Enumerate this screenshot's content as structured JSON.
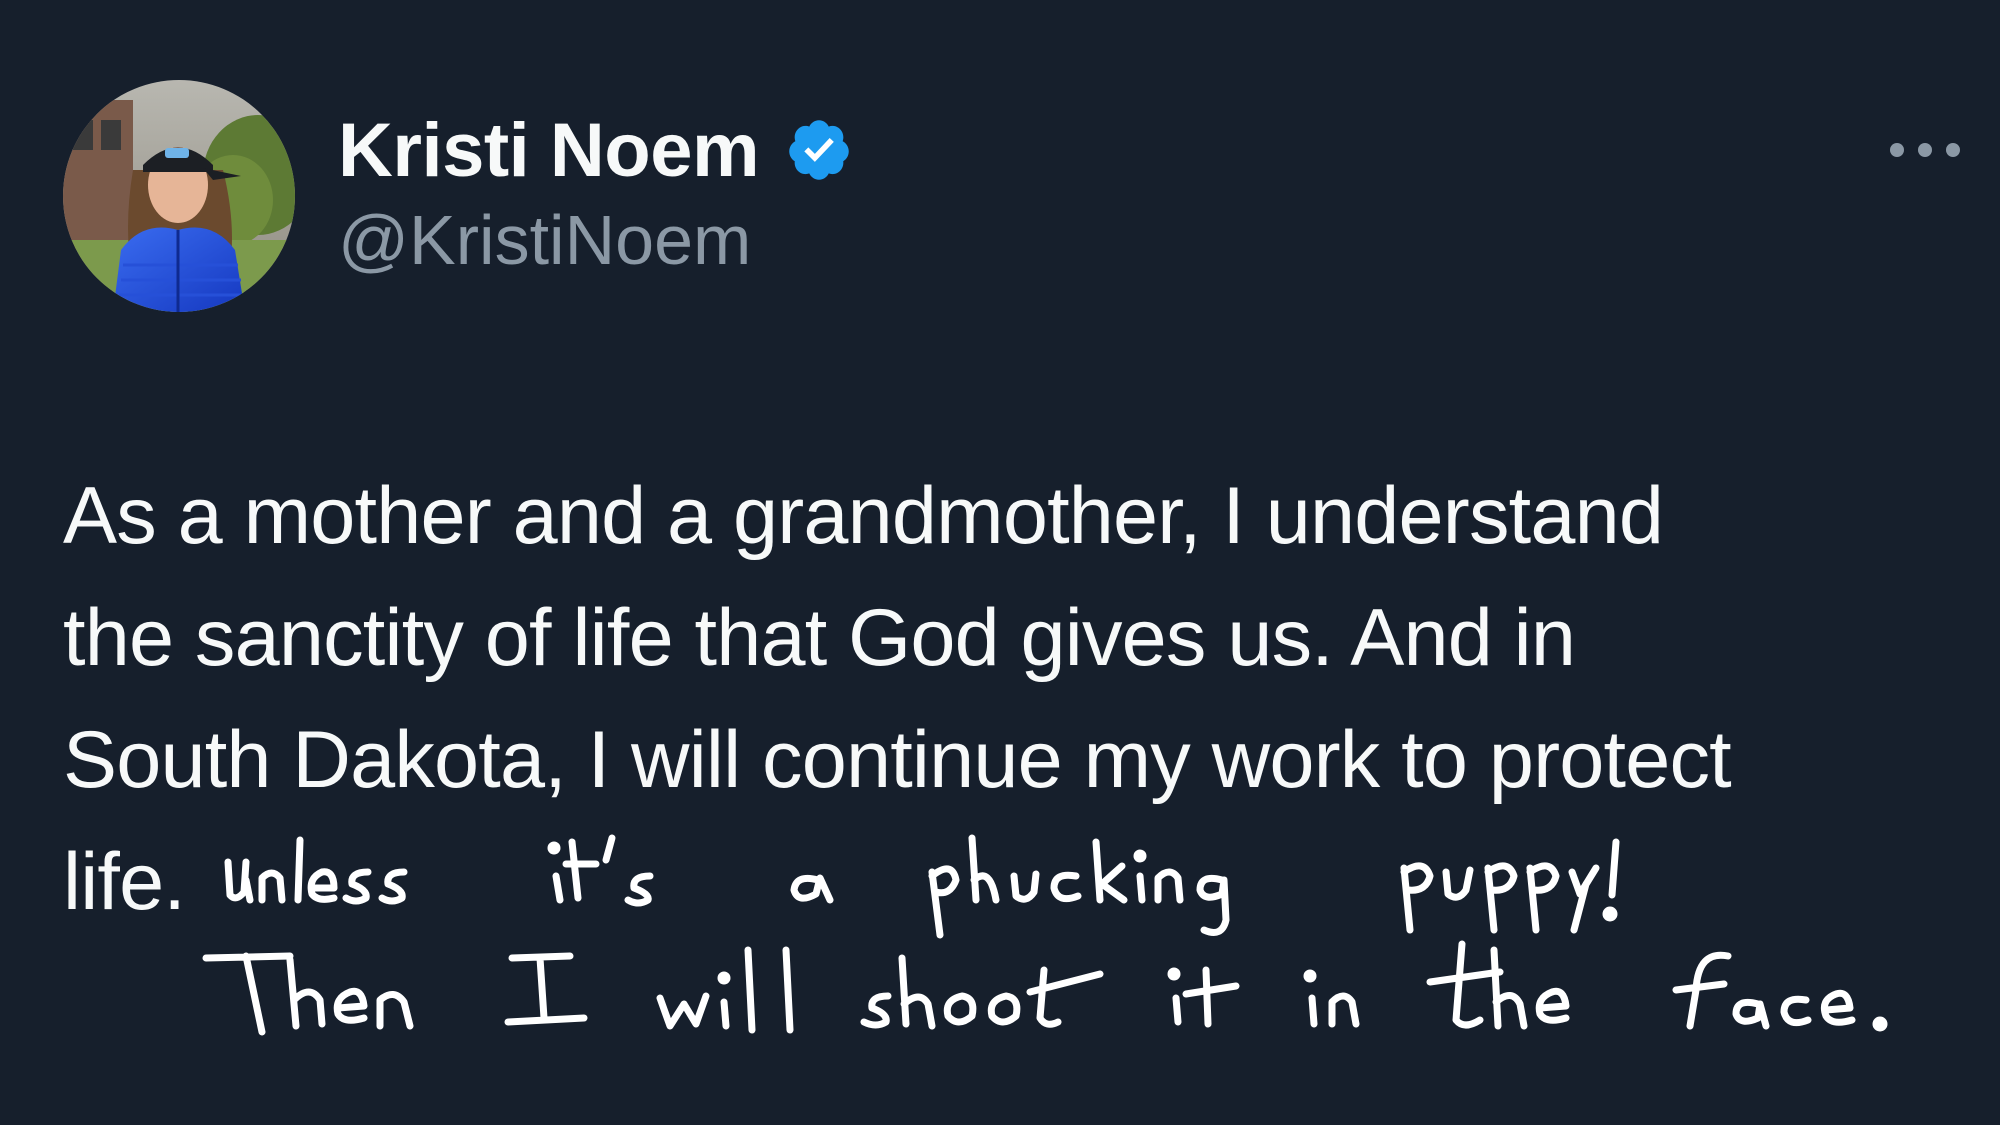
{
  "tweet": {
    "author": {
      "display_name": "Kristi Noem",
      "handle": "@KristiNoem",
      "verified": true,
      "avatar_icon": "profile-photo"
    },
    "body_lines": [
      "As a mother and a grandmother, I understand",
      "the sanctity of life that God gives us. And in",
      "South Dakota, I will continue my work to protect",
      "life."
    ],
    "handwritten_annotation": [
      "Unless it's a phucking puppy!",
      "Then I will shoot it in the face."
    ],
    "more_icon": "more-options-icon"
  },
  "colors": {
    "background": "#161f2c",
    "text_primary": "#f7f9f9",
    "text_secondary": "#8b98a5",
    "verified_blue": "#1d9bf0"
  }
}
